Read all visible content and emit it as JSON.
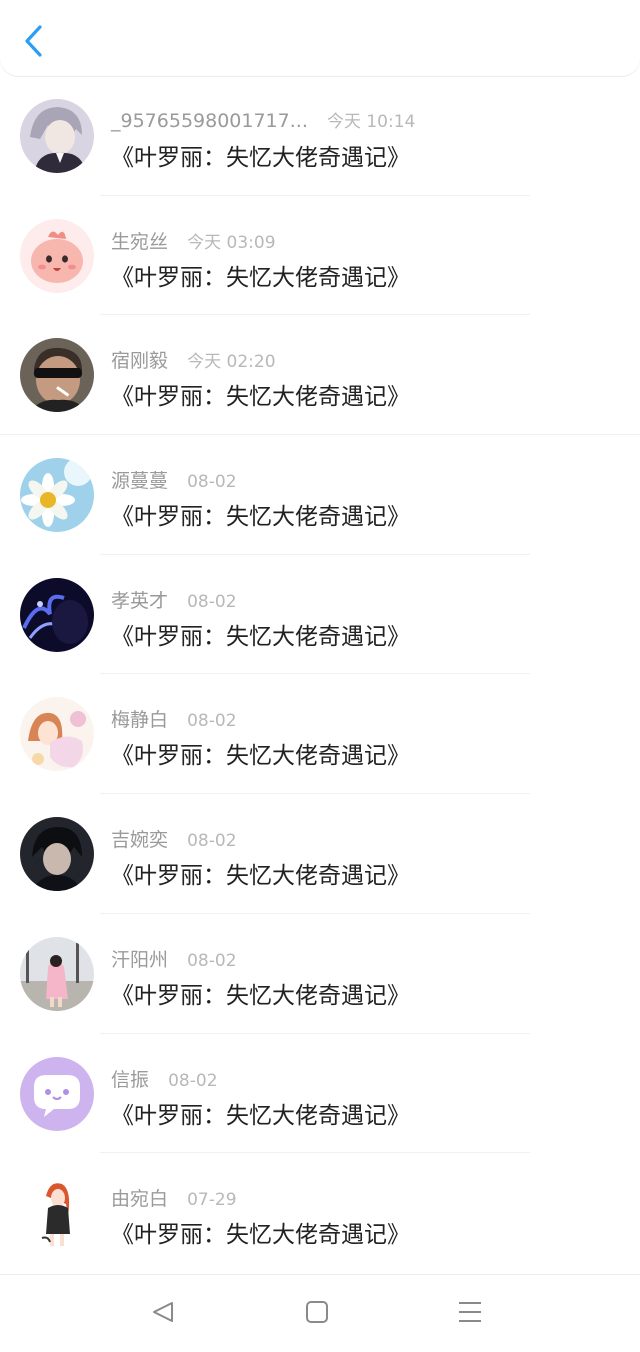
{
  "header": {
    "back_icon": "chevron-left-icon",
    "accent": "#2a9df4"
  },
  "items": [
    {
      "name": "_95765598001717...",
      "time": "今天 10:14",
      "message": "《叶罗丽：失忆大佬奇遇记》"
    },
    {
      "name": "生宛丝",
      "time": "今天 03:09",
      "message": "《叶罗丽：失忆大佬奇遇记》"
    },
    {
      "name": "宿刚毅",
      "time": "今天 02:20",
      "message": "《叶罗丽：失忆大佬奇遇记》"
    },
    {
      "name": "源蔓蔓",
      "time": "08-02",
      "message": "《叶罗丽：失忆大佬奇遇记》"
    },
    {
      "name": "孝英才",
      "time": "08-02",
      "message": "《叶罗丽：失忆大佬奇遇记》"
    },
    {
      "name": "梅静白",
      "time": "08-02",
      "message": "《叶罗丽：失忆大佬奇遇记》"
    },
    {
      "name": "吉婉奕",
      "time": "08-02",
      "message": "《叶罗丽：失忆大佬奇遇记》"
    },
    {
      "name": "汗阳州",
      "time": "08-02",
      "message": "《叶罗丽：失忆大佬奇遇记》"
    },
    {
      "name": "信振",
      "time": "08-02",
      "message": "《叶罗丽：失忆大佬奇遇记》"
    },
    {
      "name": "由宛白",
      "time": "07-29",
      "message": "《叶罗丽：失忆大佬奇遇记》"
    }
  ],
  "navbar": {
    "back_icon": "triangle-back-icon",
    "home_icon": "square-home-icon",
    "menu_icon": "hamburger-menu-icon"
  }
}
